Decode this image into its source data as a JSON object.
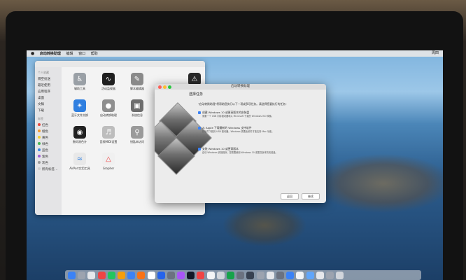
{
  "menubar": {
    "app_name": "启动转换助理",
    "items": [
      "编辑",
      "窗口",
      "帮助"
    ],
    "status": "周四"
  },
  "finder": {
    "sidebar_head_fav": "个人收藏",
    "sidebar_fav": [
      "隔空投送",
      "最近使用",
      "应用程序",
      "桌面",
      "文稿",
      "下载"
    ],
    "sidebar_head_tags": "标签",
    "sidebar_tags": [
      {
        "label": "红色",
        "color": "#e8453c"
      },
      {
        "label": "橙色",
        "color": "#f29a2e"
      },
      {
        "label": "黄色",
        "color": "#f5d02d"
      },
      {
        "label": "绿色",
        "color": "#45b654"
      },
      {
        "label": "蓝色",
        "color": "#3a87e4"
      },
      {
        "label": "紫色",
        "color": "#a05cd7"
      },
      {
        "label": "灰色",
        "color": "#9b9b9b"
      },
      {
        "label": "所有标签…",
        "color": "#cfcfcf"
      }
    ],
    "apps": [
      {
        "label": "辅助工具",
        "icon": "accessibility-icon",
        "color": "#9aa0a6"
      },
      {
        "label": "活动监视器",
        "icon": "activity-monitor-icon",
        "color": "#1f1f1f"
      },
      {
        "label": "脚本编辑器",
        "icon": "script-editor-icon",
        "color": "#8a8a8a"
      },
      {
        "label": "控制台",
        "icon": "console-icon",
        "color": "#2a2a2a"
      },
      {
        "label": "蓝牙文件交换",
        "icon": "bluetooth-icon",
        "color": "#2f7fe0"
      },
      {
        "label": "启动转换助理",
        "icon": "bootcamp-icon",
        "color": "#8f8f8f"
      },
      {
        "label": "系统信息",
        "icon": "system-info-icon",
        "color": "#6d6d6d"
      },
      {
        "label": "终端",
        "icon": "terminal-icon",
        "color": "#333333"
      },
      {
        "label": "数码测色计",
        "icon": "color-meter-icon",
        "color": "#222222"
      },
      {
        "label": "音频MIDI设置",
        "icon": "midi-icon",
        "color": "#bdbdbd"
      },
      {
        "label": "钥匙串访问",
        "icon": "keychain-icon",
        "color": "#9a9a9a"
      },
      {
        "label": "AirPort实用工具",
        "icon": "airport-icon",
        "color": "#e8e8e8"
      },
      {
        "label": "Grapher",
        "icon": "grapher-icon",
        "color": "#f0f0f0"
      }
    ]
  },
  "bootcamp": {
    "title": "启动转换助理",
    "tasks_heading": "选择任务",
    "intro": "\"启动转换助理\"将帮助您执行以下一项或多项任务。请选择您要执行的任务：",
    "options": [
      {
        "label": "创建 Windows 10 或更高版本的安装盘",
        "desc": "需要一个 USB 闪存驱动器和从 Microsoft 下载的 Windows ISO 映像。"
      },
      {
        "label": "从 Apple 下载最新的 Windows 支持软件",
        "desc": "将软件下载到 USB 驱动器。Windows 需要此软件才能支持 Mac 功能。"
      },
      {
        "label": "安装 Windows 10 或更高版本",
        "desc": "启动 Windows 安装程序。您需要使用 Windows 10 或更高版本的安装盘。"
      }
    ],
    "back": "返回",
    "continue": "继续"
  },
  "dock_colors": [
    "#3b82f6",
    "#9ca3af",
    "#e5e7eb",
    "#ef4444",
    "#22c55e",
    "#f59e0b",
    "#3b82f6",
    "#f97316",
    "#ffffff",
    "#2563eb",
    "#6b7280",
    "#a855f7",
    "#111827",
    "#ef4444",
    "#f3f4f6",
    "#d1d5db",
    "#16a34a",
    "#6b7280",
    "#374151",
    "#9ca3af",
    "#e5e7eb",
    "#6b7280",
    "#3b82f6",
    "#f3f4f6",
    "#60a5fa",
    "#e5e7eb",
    "#9ca3af",
    "#d1d5db"
  ]
}
